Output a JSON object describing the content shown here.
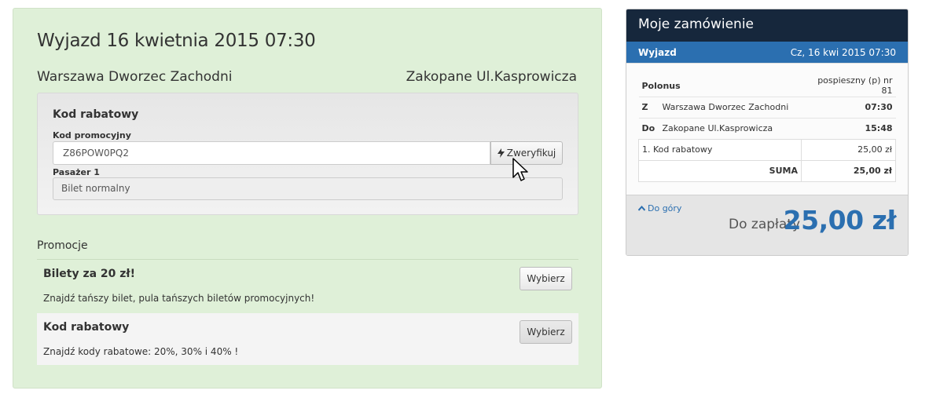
{
  "left": {
    "title": "Wyjazd 16 kwietnia 2015 07:30",
    "route_from": "Warszawa Dworzec Zachodni",
    "route_to": "Zakopane Ul.Kasprowicza",
    "discount": {
      "title": "Kod rabatowy",
      "promo_label": "Kod promocyjny",
      "promo_value": "Z86POW0PQ2",
      "verify_label": "Zweryfikuj",
      "verify_icon": "lightning-icon",
      "passenger_label": "Pasażer 1",
      "passenger_value": "Bilet normalny"
    },
    "promotions": {
      "title": "Promocje",
      "items": [
        {
          "name": "Bilety za 20 zł!",
          "desc": "Znajdź tańszy bilet, pula tańszych biletów promocyjnych!",
          "button": "Wybierz"
        },
        {
          "name": "Kod rabatowy",
          "desc": "Znajdź kody rabatowe: 20%, 30% i 40% !",
          "button": "Wybierz"
        }
      ]
    }
  },
  "order": {
    "title": "Moje zamówienie",
    "trip_label": "Wyjazd",
    "trip_date": "Cz, 16 kwi 2015 07:30",
    "carrier": "Polonus",
    "carrier_type": "pospieszny (p) nr 81",
    "from_prefix": "Z",
    "from": "Warszawa Dworzec Zachodni",
    "from_time": "07:30",
    "to_prefix": "Do",
    "to": "Zakopane Ul.Kasprowicza",
    "to_time": "15:48",
    "line_item": "1. Kod rabatowy",
    "line_amount": "25,00 zł",
    "sum_label": "SUMA",
    "sum_amount": "25,00 zł",
    "to_top": "Do góry",
    "pay_label": "Do zapłaty",
    "pay_amount": "25,00 zł"
  },
  "colors": {
    "panel_green": "#dff0d8",
    "header_dark": "#16273c",
    "accent_blue": "#2b6fb0"
  }
}
